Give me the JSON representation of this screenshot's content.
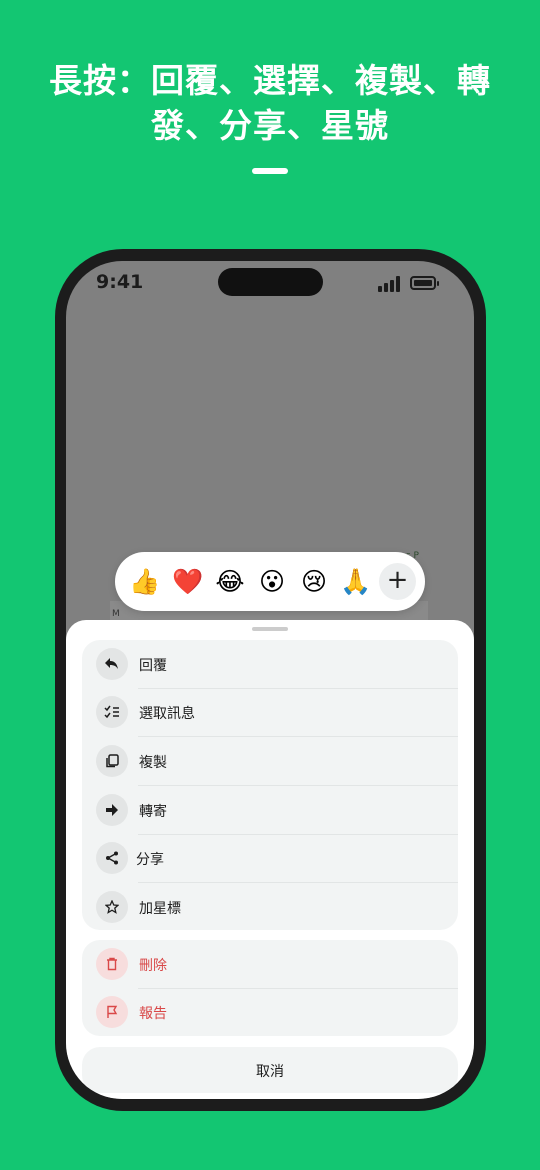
{
  "promo": {
    "headline_line1": "長按：回覆、選擇、複製、轉",
    "headline_line2": "發、分享、星號"
  },
  "status_bar": {
    "time": "9:41"
  },
  "background_chat": {
    "fragment_right": "s P",
    "fragment_left": "M"
  },
  "reaction_bar": {
    "emojis": [
      "👍",
      "❤️",
      "😂",
      "😮",
      "😢",
      "🙏"
    ],
    "more_label": "+"
  },
  "menu": {
    "actions": [
      {
        "label": "回覆",
        "icon": "reply-icon"
      },
      {
        "label": "選取訊息",
        "icon": "checklist-icon"
      },
      {
        "label": "複製",
        "icon": "copy-icon"
      },
      {
        "label": "轉寄",
        "icon": "forward-arrow-icon"
      },
      {
        "label": "分享",
        "icon": "share-icon"
      },
      {
        "label": "加星標",
        "icon": "star-icon"
      }
    ],
    "danger_actions": [
      {
        "label": "刪除",
        "icon": "trash-icon"
      },
      {
        "label": "報告",
        "icon": "flag-icon"
      }
    ],
    "cancel_label": "取消"
  },
  "colors": {
    "background": "#13c672",
    "danger": "#d94848",
    "sheet_group": "#f2f4f4"
  }
}
